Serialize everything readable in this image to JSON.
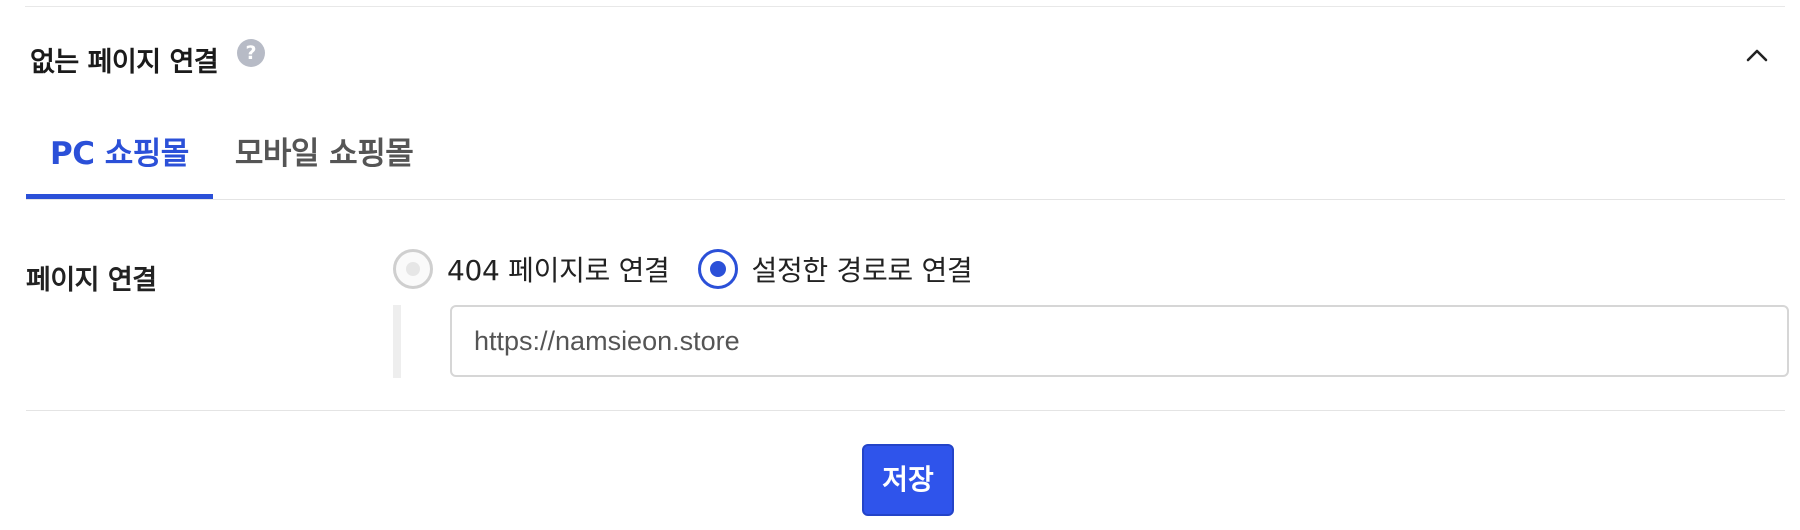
{
  "section": {
    "title": "없는 페이지 연결",
    "help_icon": "question-mark",
    "help_symbol": "?",
    "collapse_icon": "chevron-up"
  },
  "tabs": [
    {
      "label": "PC 쇼핑몰",
      "active": true
    },
    {
      "label": "모바일 쇼핑몰",
      "active": false
    }
  ],
  "page_link": {
    "label": "페이지 연결",
    "options": [
      {
        "label": "404 페이지로 연결",
        "checked": false
      },
      {
        "label": "설정한 경로로 연결",
        "checked": true
      }
    ],
    "url_value": "https://namsieon.store"
  },
  "save_label": "저장",
  "colors": {
    "accent": "#2b50d8",
    "button": "#2f54eb",
    "help_icon": "#b7bbc6"
  }
}
